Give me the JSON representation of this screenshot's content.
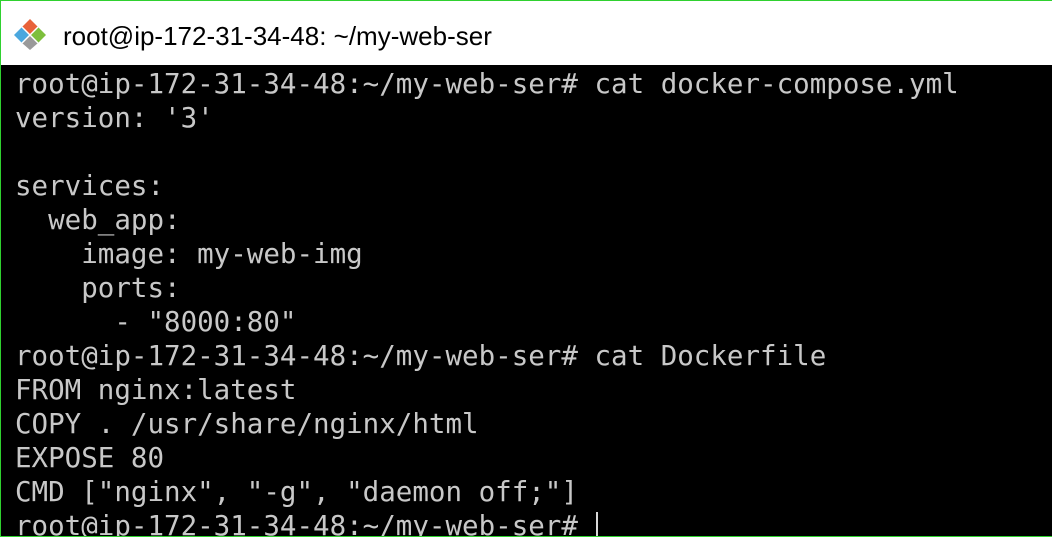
{
  "window": {
    "title": "root@ip-172-31-34-48: ~/my-web-ser",
    "icon": "git-diamond-icon"
  },
  "colors": {
    "border": "#2fd12f",
    "terminal_bg": "#000000",
    "terminal_fg": "#c8c8c8"
  },
  "terminal": {
    "lines": [
      "root@ip-172-31-34-48:~/my-web-ser# cat docker-compose.yml",
      "version: '3'",
      "",
      "services:",
      "  web_app:",
      "    image: my-web-img",
      "    ports:",
      "      - \"8000:80\"",
      "root@ip-172-31-34-48:~/my-web-ser# cat Dockerfile",
      "FROM nginx:latest",
      "COPY . /usr/share/nginx/html",
      "EXPOSE 80",
      "CMD [\"nginx\", \"-g\", \"daemon off;\"]",
      "root@ip-172-31-34-48:~/my-web-ser# "
    ]
  }
}
